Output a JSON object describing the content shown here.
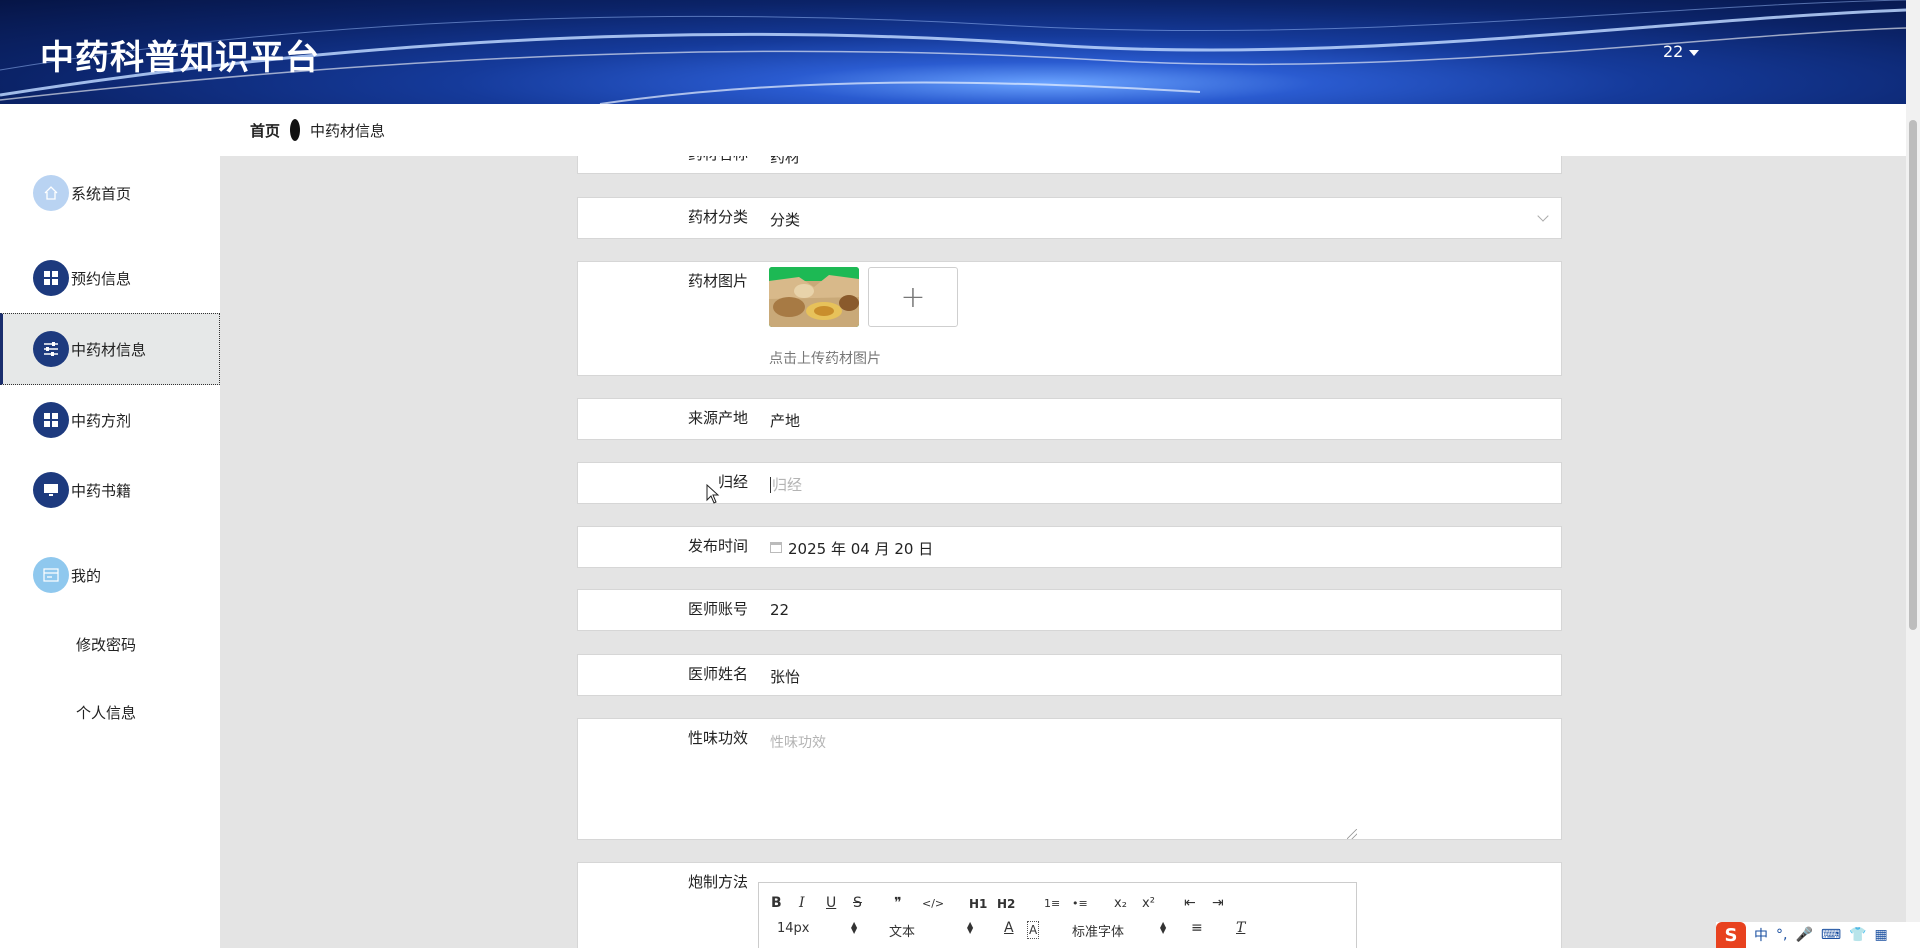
{
  "header": {
    "title": "中药科普知识平台",
    "user": "22"
  },
  "breadcrumb": {
    "home": "首页",
    "current": "中药材信息"
  },
  "sidebar": {
    "items": [
      {
        "label": "系统首页",
        "icon": "home-icon"
      },
      {
        "label": "预约信息",
        "icon": "grid-icon"
      },
      {
        "label": "中药材信息",
        "icon": "sliders-icon",
        "active": true
      },
      {
        "label": "中药方剂",
        "icon": "grid-icon"
      },
      {
        "label": "中药书籍",
        "icon": "monitor-icon"
      },
      {
        "label": "我的",
        "icon": "card-icon"
      }
    ],
    "sub_items": [
      "修改密码",
      "个人信息"
    ]
  },
  "form": {
    "name": {
      "label": "药材名称",
      "value": "药材"
    },
    "category": {
      "label": "药材分类",
      "value": "分类"
    },
    "image": {
      "label": "药材图片",
      "tip": "点击上传药材图片",
      "add": "+"
    },
    "origin": {
      "label": "来源产地",
      "value": "产地"
    },
    "meridian": {
      "label": "归经",
      "placeholder": "归经"
    },
    "publish": {
      "label": "发布时间",
      "value": "2025 年 04 月 20 日"
    },
    "doctor_account": {
      "label": "医师账号",
      "value": "22"
    },
    "doctor_name": {
      "label": "医师姓名",
      "value": "张怡"
    },
    "efficacy": {
      "label": "性味功效",
      "placeholder": "性味功效"
    },
    "processing": {
      "label": "炮制方法"
    }
  },
  "editor": {
    "font_size": "14px",
    "block_format": "文本",
    "font_family": "标准字体",
    "buttons": [
      "B",
      "I",
      "U",
      "S",
      "❞",
      "</>",
      "H1",
      "H2",
      "1≡",
      "•≡",
      "x₂",
      "x²",
      "⇤",
      "⇥"
    ]
  },
  "ime": {
    "logo": "S",
    "lang": "中",
    "punct": "°,"
  },
  "colors": {
    "nav_dark": "#1d3a7e",
    "header_dark": "#0b2368",
    "page_bg": "#e4e4e4"
  }
}
